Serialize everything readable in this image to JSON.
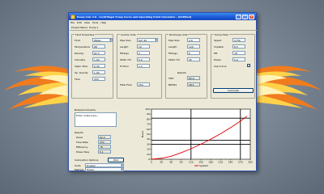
{
  "window": {
    "title": "Pump Calc 2.0 - Centrifugal Pump Curve and Operating Point Calculator - [Untitled]",
    "menu": [
      "File",
      "Edit",
      "View",
      "Tools",
      "Help"
    ]
  },
  "toolbar": {
    "project_label": "Project Name",
    "project_value": "Pump 1"
  },
  "groups": {
    "fluid": {
      "title": "Fluid Properties",
      "rows": [
        {
          "label": "Fluid",
          "value": "Water"
        },
        {
          "label": "Temperature",
          "value": "68"
        },
        {
          "label": "Density",
          "value": "62.3"
        },
        {
          "label": "Viscosity",
          "value": "1.00"
        },
        {
          "label": "Vapor Pres.",
          "value": "0.34"
        },
        {
          "label": "Sp. Gravity",
          "value": "1.00"
        },
        {
          "label": "Flow",
          "value": "250"
        }
      ]
    },
    "suction": {
      "title": "Suction Side",
      "rows": [
        {
          "label": "Pipe Size",
          "value": "Sch 40"
        },
        {
          "label": "Length",
          "value": "10"
        },
        {
          "label": "Fittings",
          "value": "2"
        },
        {
          "label": "Static Hd",
          "value": "5.0"
        },
        {
          "label": "Friction",
          "value": "1.2"
        }
      ],
      "flow_label": "Total Flow",
      "flow_value": "250"
    },
    "discharge": {
      "title": "Discharge Side",
      "rows": [
        {
          "label": "Pipe Size",
          "value": "4.0"
        },
        {
          "label": "Length",
          "value": "120"
        },
        {
          "label": "Fittings",
          "value": "6"
        },
        {
          "label": "Static Hd",
          "value": "45"
        }
      ],
      "result_title": "Results",
      "result_rows": [
        {
          "label": "TDH",
          "value": "62.4"
        },
        {
          "label": "NPSHa",
          "value": "28.1"
        }
      ],
      "calc_button": "Calculate"
    },
    "pump": {
      "title": "Pump Data",
      "rows": [
        {
          "label": "Speed",
          "value": "1750"
        },
        {
          "label": "Impeller",
          "value": "8.5"
        },
        {
          "label": "Eff.",
          "value": "78"
        },
        {
          "label": "Power",
          "value": "5.0"
        }
      ],
      "check_label": "Use Curve",
      "check_value": true
    }
  },
  "comments": {
    "title": "Notes/Comments",
    "text": "Enter notes here..."
  },
  "results_panel": {
    "title": "Results",
    "rows": [
      {
        "label": "Head",
        "value": "62.4"
      },
      {
        "label": "Flow Rate",
        "value": "250"
      },
      {
        "label": "Efficiency",
        "value": "78"
      },
      {
        "label": "Power Req.",
        "value": "5.1"
      }
    ]
  },
  "options": {
    "title": "Calculation Options",
    "button": "Plot",
    "rows": [
      {
        "label": "Units",
        "value": "English"
      },
      {
        "label": "Method",
        "value": "Hazen"
      }
    ]
  },
  "chart_data": {
    "type": "line",
    "title": "",
    "xlabel": "",
    "ylabel": "Head",
    "xlim": [
      0,
      300
    ],
    "ylim": [
      0,
      100
    ],
    "x_ticks": [
      "0",
      "30",
      "60",
      "90",
      "120",
      "150",
      "180",
      "210",
      "240",
      "270",
      "300"
    ],
    "y_ticks": [
      "0",
      "10",
      "20",
      "30",
      "40",
      "50",
      "60",
      "70",
      "80",
      "90",
      "100"
    ],
    "grid": false,
    "series": [
      {
        "color": "#e00000",
        "x": [
          0,
          30,
          60,
          90,
          120,
          150,
          180,
          210,
          240,
          270,
          290
        ],
        "y": [
          0,
          2,
          6,
          13,
          21,
          30,
          40,
          51,
          63,
          76,
          86
        ]
      }
    ],
    "reference_lines": {
      "vertical": [
        120,
        270
      ],
      "horizontal": [
        30,
        38,
        82
      ]
    },
    "legend": "bottom-center",
    "legend_entries": [
      "System"
    ]
  },
  "colors": {
    "titlebar": "#1c5bd6",
    "window_bg": "#ece9d8",
    "curve": "#e00000"
  }
}
